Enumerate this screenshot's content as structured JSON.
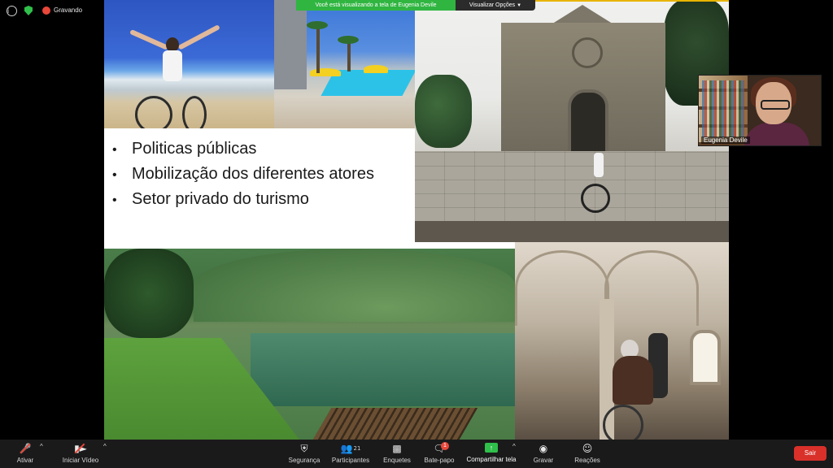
{
  "status": {
    "info_icon": "info-icon",
    "security_icon": "shield-icon",
    "recording_label": "Gravando"
  },
  "share_banner": {
    "message": "Você está visualizando a tela de Eugenia Devile",
    "view_options_label": "Visualizar Opções",
    "accent_color": "#30b541"
  },
  "slide": {
    "bullets": [
      "Politicas públicas",
      "Mobilização dos diferentes atores",
      "Setor privado do turismo"
    ]
  },
  "video": {
    "participant_name": "Eugenia Devile"
  },
  "toolbar": {
    "mute_label": "Ativar",
    "video_label": "Iniciar Vídeo",
    "security_label": "Segurança",
    "participants_label": "Participantes",
    "participants_count": "21",
    "polls_label": "Enquetes",
    "chat_label": "Bate-papo",
    "chat_badge": "1",
    "share_label": "Compartilhar tela",
    "record_label": "Gravar",
    "reactions_label": "Reações",
    "leave_label": "Sair",
    "leave_color": "#d9302a"
  }
}
